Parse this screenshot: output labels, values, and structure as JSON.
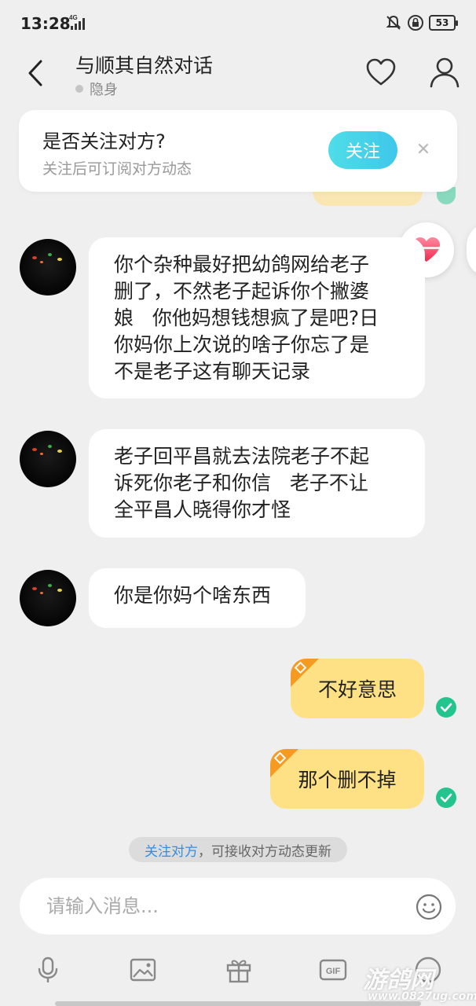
{
  "status_bar": {
    "time": "13:28",
    "network": "4G",
    "battery": "53"
  },
  "header": {
    "title": "与顺其自然对话",
    "presence": "隐身"
  },
  "follow_card": {
    "title": "是否关注对方?",
    "subtitle": "关注后可订阅对方动态",
    "button": "关注"
  },
  "messages": [
    {
      "side": "in",
      "text": "你个杂种最好把幼鸽网给老子\n删了，不然老子起诉你个撇婆\n娘   你他妈想钱想疯了是吧?日\n你妈你上次说的啥子你忘了是\n不是老子这有聊天记录"
    },
    {
      "side": "in",
      "text": "老子回平昌就去法院老子不起\n诉死你老子和你信   老子不让\n全平昌人晓得你才怪"
    },
    {
      "side": "in",
      "text": "你是你妈个啥东西"
    },
    {
      "side": "out",
      "text": "不好意思",
      "read": true
    },
    {
      "side": "out",
      "text": "那个删不掉",
      "read": true
    }
  ],
  "system_hint": {
    "link": "关注对方",
    "rest": "，可接收对方动态更新"
  },
  "input": {
    "placeholder": "请输入消息..."
  },
  "toolbar": {
    "gif_label": "GIF"
  },
  "watermark": {
    "main": "游鸽网",
    "url": "www.0827ug.com"
  },
  "colors": {
    "accent": "#3ec7ea",
    "bubble_out": "#ffe185",
    "read": "#23c48e",
    "link": "#2e8ee8"
  },
  "icons": [
    "chevron-left-icon",
    "heart-outline-icon",
    "user-icon",
    "close-icon",
    "heart-filled-icon",
    "emoji-icon",
    "mic-icon",
    "image-icon",
    "gift-icon",
    "gif-icon",
    "more-icon",
    "check-icon"
  ]
}
